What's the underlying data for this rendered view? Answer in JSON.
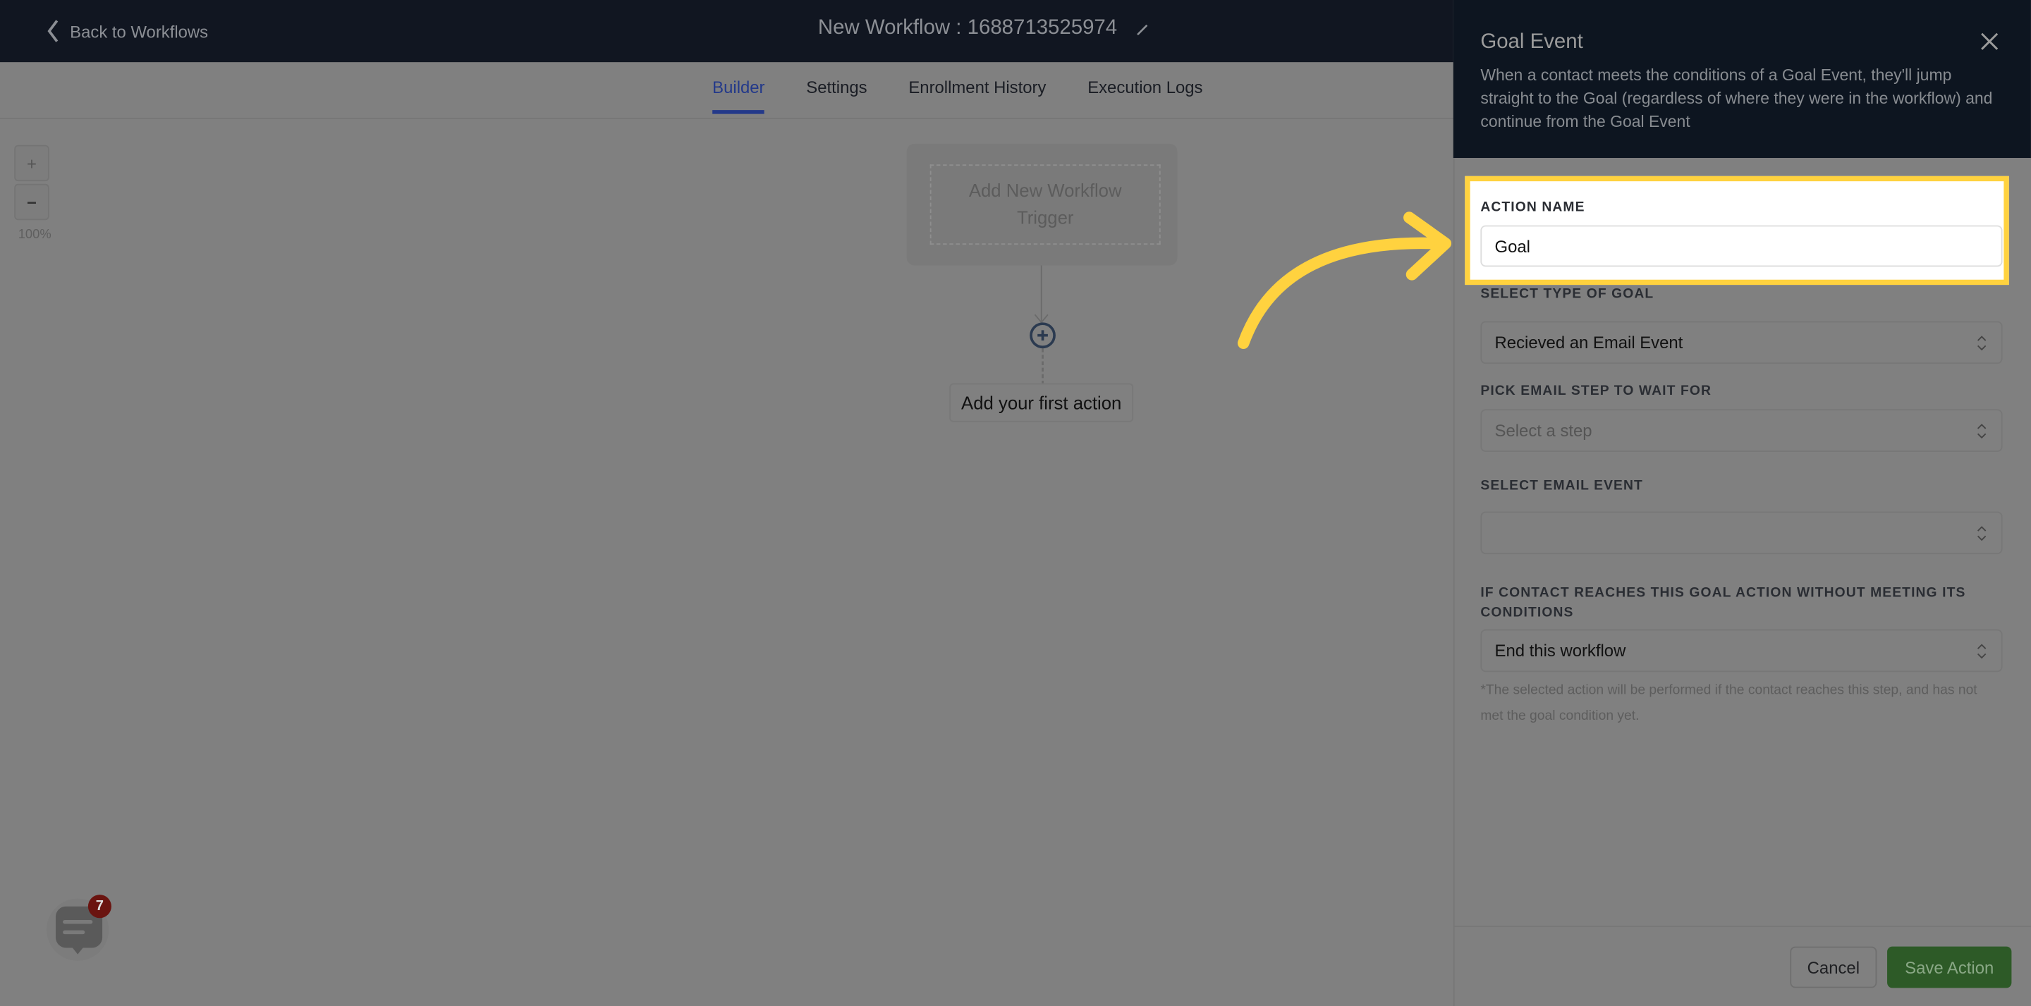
{
  "header": {
    "back_label": "Back to Workflows",
    "title": "New Workflow : 1688713525974"
  },
  "tabs": [
    {
      "label": "Builder",
      "active": true
    },
    {
      "label": "Settings"
    },
    {
      "label": "Enrollment History"
    },
    {
      "label": "Execution Logs"
    }
  ],
  "zoom": {
    "in_label": "+",
    "out_label": "−",
    "level": "100%"
  },
  "canvas": {
    "trigger_label": "Add New Workflow Trigger",
    "first_action_label": "Add your first action"
  },
  "chat": {
    "badge_count": "7"
  },
  "panel": {
    "title": "Goal Event",
    "description": "When a contact meets the conditions of a Goal Event, they'll jump straight to the Goal (regardless of where they were in the workflow) and continue from the Goal Event",
    "action_name_label": "ACTION NAME",
    "action_name_value": "Goal",
    "goal_type_label": "SELECT TYPE OF GOAL",
    "goal_type_value": "Recieved an Email Event",
    "email_step_label": "PICK EMAIL STEP TO WAIT FOR",
    "email_step_placeholder": "Select a step",
    "email_event_label": "SELECT EMAIL EVENT",
    "email_event_value": "",
    "fallback_label": "IF CONTACT REACHES THIS GOAL ACTION WITHOUT MEETING ITS CONDITIONS",
    "fallback_value": "End this workflow",
    "fallback_note": "*The selected action will be performed if the contact reaches this step, and has not met the goal condition yet.",
    "cancel_label": "Cancel",
    "save_label": "Save Action"
  },
  "colors": {
    "highlight": "#ffd23f",
    "save_button": "#2d5a27",
    "active_tab": "#23398a",
    "header_bg": "#111621"
  }
}
